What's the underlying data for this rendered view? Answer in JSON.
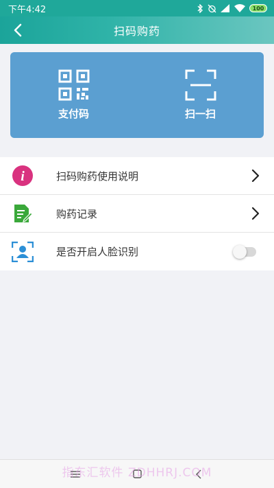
{
  "status_bar": {
    "time": "下午4:42",
    "battery": "100"
  },
  "nav": {
    "title": "扫码购药"
  },
  "scan_card": {
    "pay_code_label": "支付码",
    "scan_label": "扫一扫"
  },
  "menu": {
    "items": [
      {
        "label": "扫码购药使用说明",
        "icon": "info-icon"
      },
      {
        "label": "购药记录",
        "icon": "record-icon"
      },
      {
        "label": "是否开启人脸识别",
        "icon": "face-id-icon",
        "toggle_on": false
      }
    ]
  },
  "watermark": "指东汇软件 ZDHHRJ.COM",
  "colors": {
    "accent": "#1fa89a",
    "card": "#5b9fd1",
    "info_icon": "#d9327f",
    "record_icon": "#3aa83a",
    "face_icon": "#2c8fd6"
  }
}
